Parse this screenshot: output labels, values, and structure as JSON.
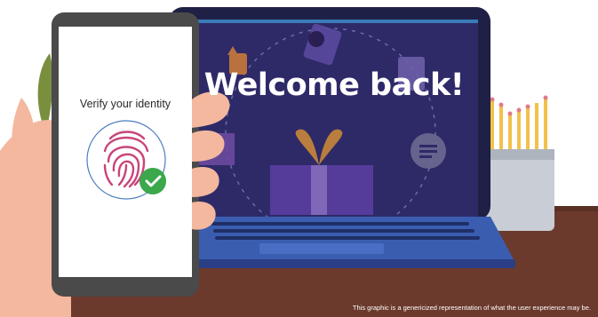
{
  "laptop": {
    "welcome_text": "Welcome back!"
  },
  "phone": {
    "prompt": "Verify your identity",
    "icon": "fingerprint-icon",
    "check_icon": "checkmark-icon"
  },
  "footer": {
    "disclaimer": "This graphic is a genericized representation of what the user experience may be."
  },
  "colors": {
    "screen": "#2e2a68",
    "laptop_frame": "#1f2045",
    "desk": "#6b3a2c",
    "fingerprint": "#c9457a",
    "check": "#3aa84b",
    "skin": "#f3b89e"
  }
}
